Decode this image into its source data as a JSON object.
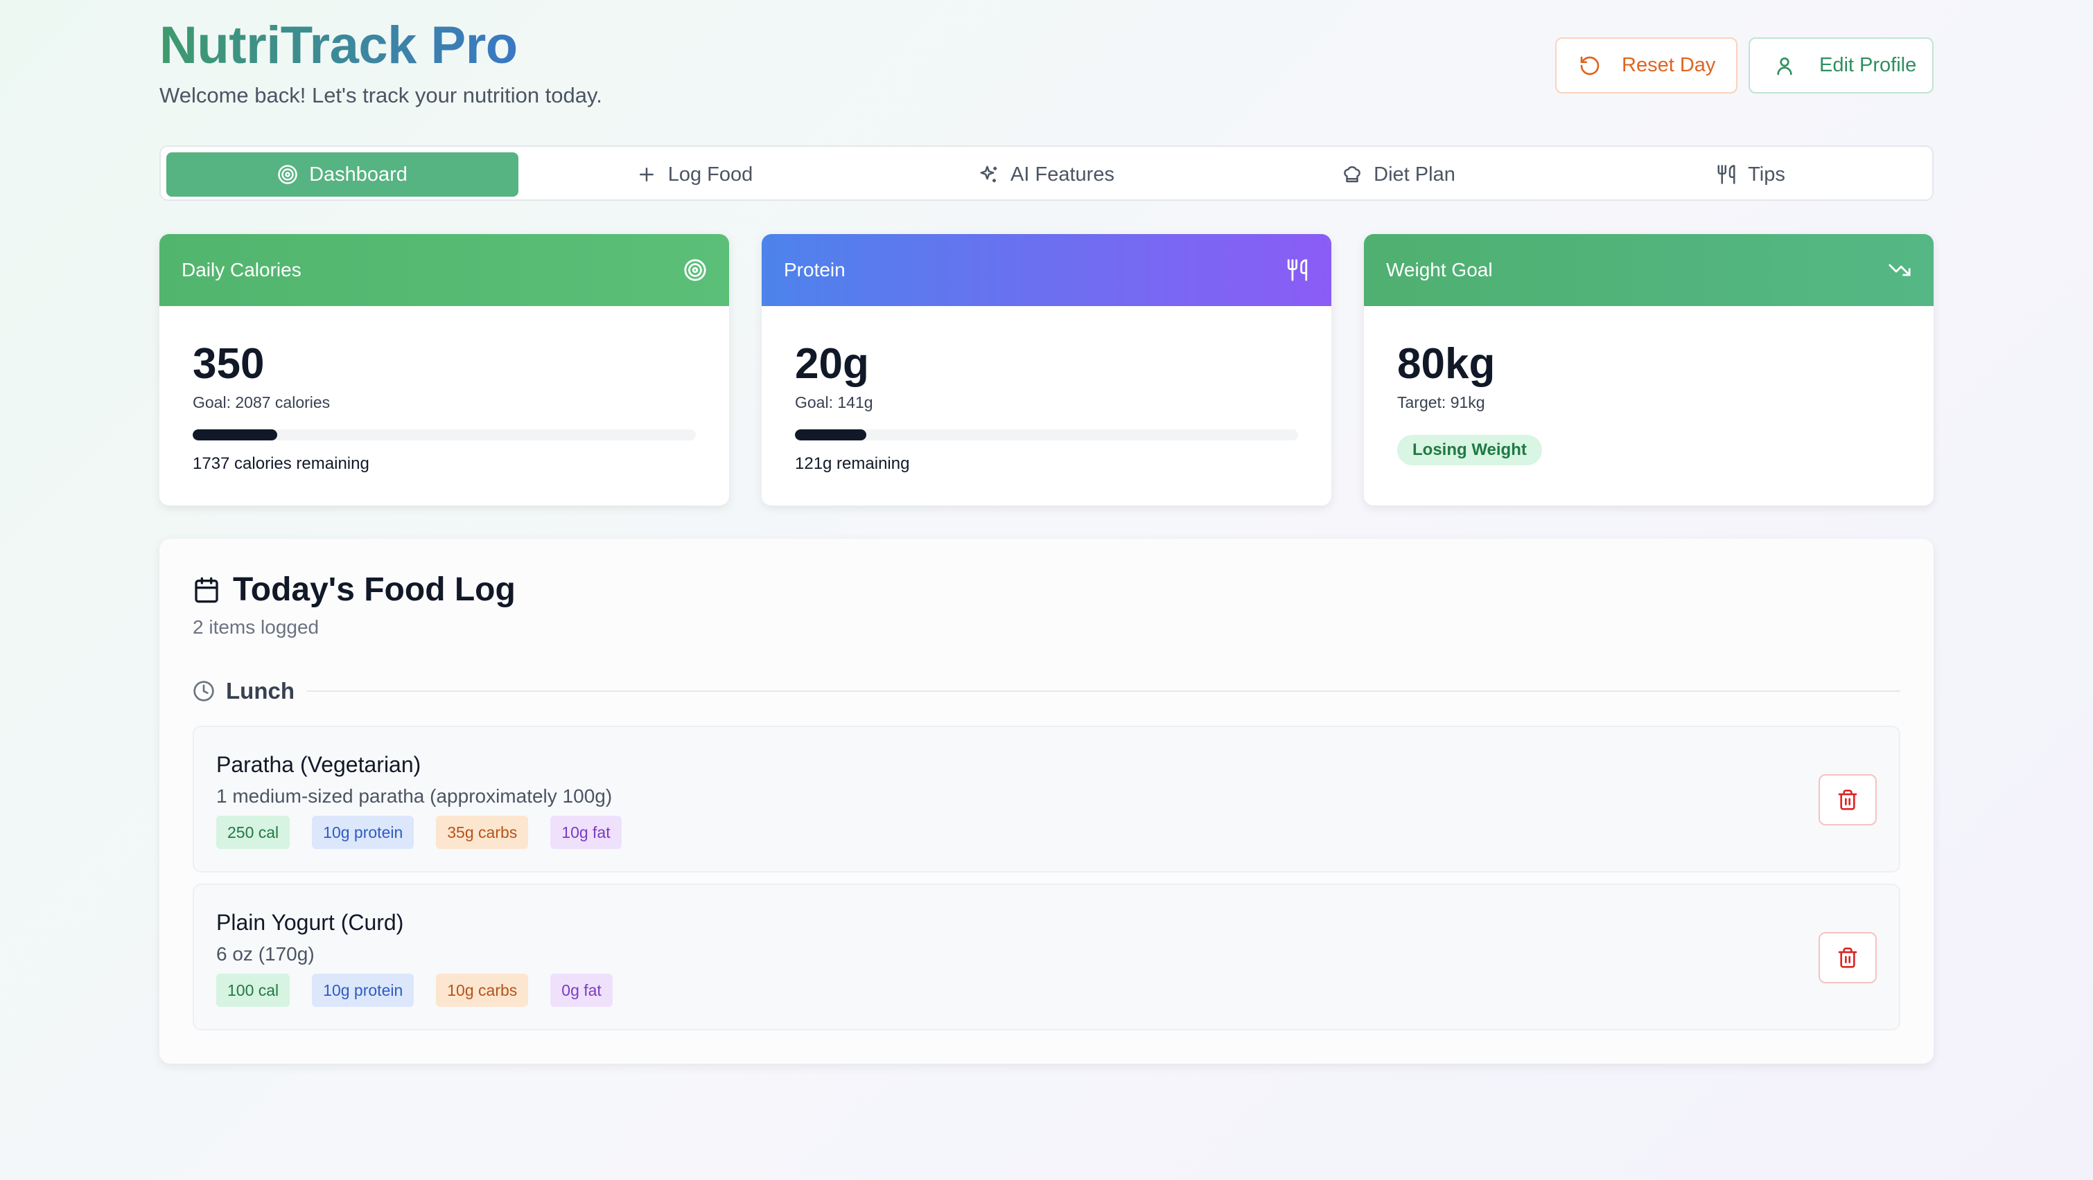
{
  "app": {
    "title": "NutriTrack Pro",
    "subtitle": "Welcome back! Let's track your nutrition today."
  },
  "header_buttons": {
    "reset_label": "Reset Day",
    "profile_label": "Edit Profile"
  },
  "tabs": [
    {
      "label": "Dashboard",
      "icon": "target-icon",
      "active": true
    },
    {
      "label": "Log Food",
      "icon": "plus-icon",
      "active": false
    },
    {
      "label": "AI Features",
      "icon": "sparkles-icon",
      "active": false
    },
    {
      "label": "Diet Plan",
      "icon": "chef-hat-icon",
      "active": false
    },
    {
      "label": "Tips",
      "icon": "utensils-icon",
      "active": false
    }
  ],
  "cards": {
    "calories": {
      "title": "Daily Calories",
      "value": "350",
      "goal": "Goal: 2087 calories",
      "progress": 0.168,
      "remaining": "1737 calories remaining"
    },
    "protein": {
      "title": "Protein",
      "value": "20g",
      "goal": "Goal: 141g",
      "progress": 0.142,
      "remaining": "121g remaining"
    },
    "weight": {
      "title": "Weight Goal",
      "value": "80kg",
      "target": "Target: 91kg",
      "status": "Losing Weight"
    }
  },
  "food_log": {
    "title": "Today's Food Log",
    "count": "2 items logged",
    "meal": "Lunch",
    "items": [
      {
        "name": "Paratha (Vegetarian)",
        "portion": "1 medium-sized paratha (approximately 100g)",
        "cal": "250 cal",
        "protein": "10g protein",
        "carbs": "35g carbs",
        "fat": "10g fat"
      },
      {
        "name": "Plain Yogurt (Curd)",
        "portion": "6 oz (170g)",
        "cal": "100 cal",
        "protein": "10g protein",
        "carbs": "10g carbs",
        "fat": "0g fat"
      }
    ]
  },
  "colors": {
    "primary_green": "#56b382",
    "accent_blue": "#3a78c4",
    "accent_purple": "#8b5cf6",
    "warning_orange": "#e0641f",
    "danger_red": "#dc2626"
  }
}
